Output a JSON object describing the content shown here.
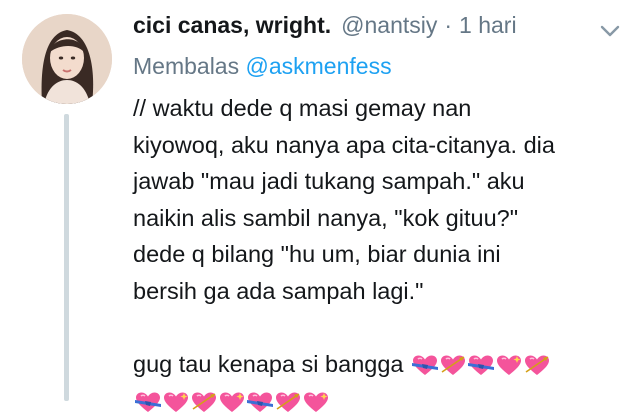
{
  "tweet": {
    "display_name": "cici canas, wright.",
    "handle": "@nantsiy",
    "separator": "·",
    "time": "1 hari",
    "reply_prefix": "Membalas",
    "reply_mention": "@askmenfess",
    "body_lines": [
      "// waktu dede q masi gemay nan",
      "kiyowoq, aku nanya apa cita-citanya. dia",
      "jawab \"mau jadi tukang sampah.\" aku",
      "naikin alis sambil nanya, \"kok gituu?\"",
      "dede q bilang \"hu um, biar dunia ini",
      "bersih ga ada sampah lagi.\""
    ],
    "closing_line": "gug tau kenapa si bangga",
    "emoji_line1": [
      "heart-with-ribbon",
      "heart-with-arrow",
      "heart-with-ribbon",
      "sparkling-heart",
      "heart-with-arrow"
    ],
    "emoji_line2": [
      "heart-with-ribbon",
      "sparkling-heart",
      "heart-with-arrow",
      "sparkling-heart",
      "heart-with-ribbon",
      "heart-with-arrow",
      "sparkling-heart"
    ]
  },
  "colors": {
    "name": "#14171a",
    "secondary": "#657786",
    "mention": "#1da1f2",
    "thread_line": "#cfd9de",
    "heart_pink": "#f4549b",
    "ribbon_blue": "#3b6fd6"
  }
}
